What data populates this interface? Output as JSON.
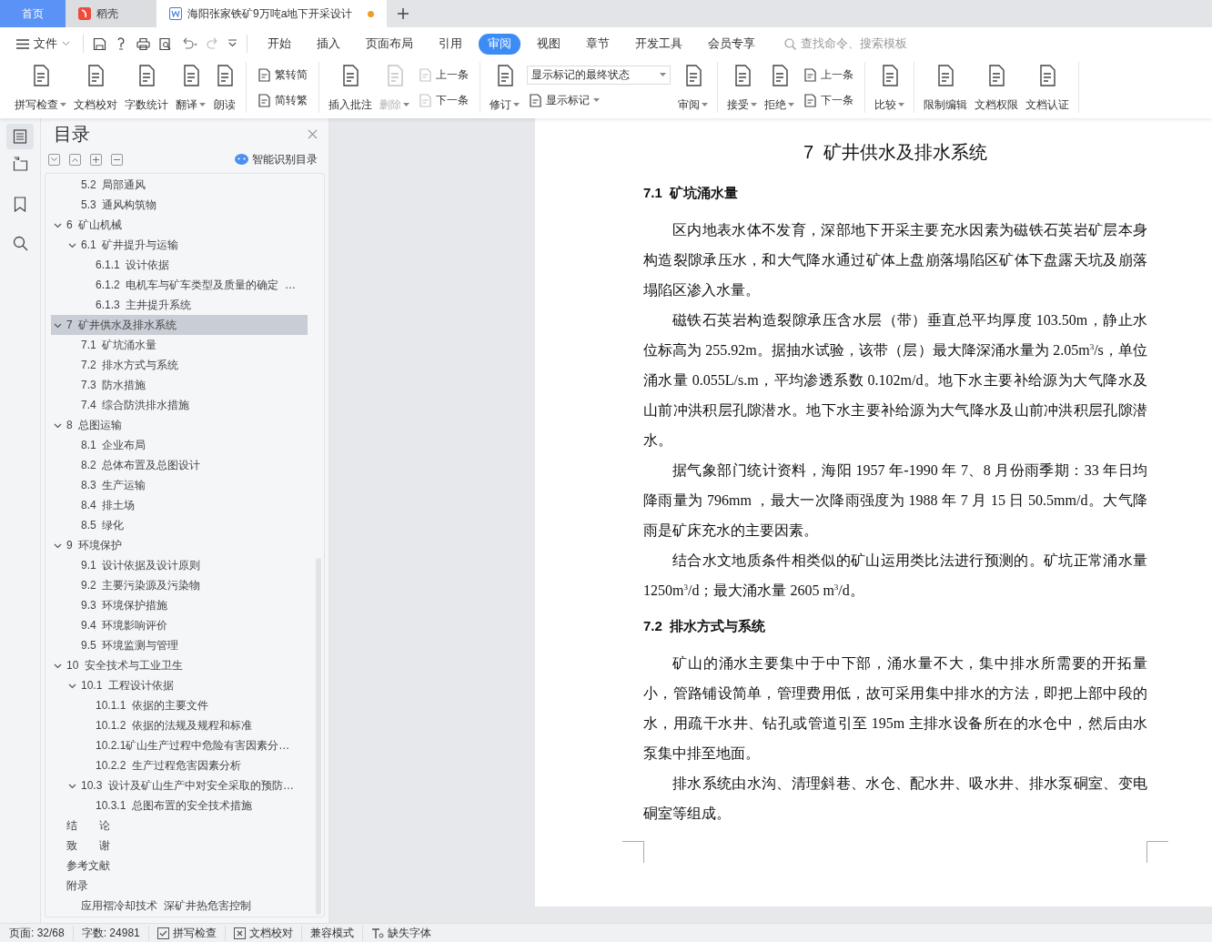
{
  "tabs": [
    {
      "label": "首页",
      "kind": "home",
      "selected": false
    },
    {
      "label": "稻壳",
      "kind": "app",
      "selected": false
    },
    {
      "label": "海阳张家铁矿9万吨a地下开采设计",
      "kind": "document",
      "selected": true,
      "modified": true
    }
  ],
  "menu": {
    "file": "文件",
    "tabs": [
      {
        "label": "开始",
        "selected": false
      },
      {
        "label": "插入",
        "selected": false
      },
      {
        "label": "页面布局",
        "selected": false
      },
      {
        "label": "引用",
        "selected": false
      },
      {
        "label": "审阅",
        "selected": true
      },
      {
        "label": "视图",
        "selected": false
      },
      {
        "label": "章节",
        "selected": false
      },
      {
        "label": "开发工具",
        "selected": false
      },
      {
        "label": "会员专享",
        "selected": false
      }
    ],
    "search": {
      "placeholder": "查找命令、搜索模板"
    }
  },
  "ribbon": {
    "groups": [
      {
        "items": [
          {
            "kind": "large",
            "label": "拼写检查",
            "dropdown": true,
            "disabled": false
          },
          {
            "kind": "large",
            "label": "文档校对",
            "dropdown": false,
            "disabled": false
          },
          {
            "kind": "large",
            "label": "字数统计",
            "dropdown": false,
            "disabled": false
          },
          {
            "kind": "large",
            "label": "翻译",
            "dropdown": true,
            "disabled": false
          },
          {
            "kind": "large",
            "label": "朗读",
            "dropdown": false,
            "disabled": false
          }
        ]
      },
      {
        "items": [
          {
            "kind": "stack",
            "items": [
              {
                "kind": "small",
                "label": "繁转简",
                "dropdown": false,
                "disabled": false
              },
              {
                "kind": "small",
                "label": "简转繁",
                "dropdown": false,
                "disabled": false
              }
            ]
          }
        ]
      },
      {
        "items": [
          {
            "kind": "large",
            "label": "插入批注",
            "dropdown": false,
            "disabled": false
          },
          {
            "kind": "large",
            "label": "删除",
            "dropdown": true,
            "disabled": true
          },
          {
            "kind": "stack",
            "items": [
              {
                "kind": "small",
                "label": "上一条",
                "dropdown": false,
                "disabled": true
              },
              {
                "kind": "small",
                "label": "下一条",
                "dropdown": false,
                "disabled": true
              }
            ]
          }
        ]
      },
      {
        "items": [
          {
            "kind": "large",
            "label": "修订",
            "dropdown": true,
            "disabled": false
          },
          {
            "kind": "stack",
            "items": [
              {
                "kind": "select",
                "value": "显示标记的最终状态"
              },
              {
                "kind": "small",
                "label": "显示标记",
                "dropdown": true,
                "disabled": false
              }
            ]
          },
          {
            "kind": "large",
            "label": "审阅",
            "dropdown": true,
            "disabled": false
          }
        ]
      },
      {
        "items": [
          {
            "kind": "large",
            "label": "接受",
            "dropdown": true,
            "disabled": false
          },
          {
            "kind": "large",
            "label": "拒绝",
            "dropdown": true,
            "disabled": false
          },
          {
            "kind": "stack",
            "items": [
              {
                "kind": "small",
                "label": "上一条",
                "dropdown": false,
                "disabled": false
              },
              {
                "kind": "small",
                "label": "下一条",
                "dropdown": false,
                "disabled": false
              }
            ]
          }
        ]
      },
      {
        "items": [
          {
            "kind": "large",
            "label": "比较",
            "dropdown": true,
            "disabled": false
          }
        ]
      },
      {
        "items": [
          {
            "kind": "large",
            "label": "限制编辑",
            "dropdown": false,
            "disabled": false
          },
          {
            "kind": "large",
            "label": "文档权限",
            "dropdown": false,
            "disabled": false
          },
          {
            "kind": "large",
            "label": "文档认证",
            "dropdown": false,
            "disabled": false
          }
        ]
      }
    ]
  },
  "toc": {
    "title": "目录",
    "smart_button": "智能识别目录",
    "items": [
      {
        "children": [
          {
            "label": "5.2  局部通风",
            "selected": false
          },
          {
            "label": "5.3  通风构筑物",
            "selected": false
          }
        ]
      },
      {
        "label": "6  矿山机械",
        "selected": false,
        "expanded": true,
        "children": [
          {
            "label": "6.1  矿井提升与运输",
            "selected": false,
            "expanded": true,
            "children": [
              {
                "label": "6.1.1  设计依据",
                "selected": false
              },
              {
                "label": "6.1.2  电机车与矿车类型及质量的确定  …",
                "selected": false
              },
              {
                "label": "6.1.3  主井提升系统",
                "selected": false
              }
            ]
          }
        ]
      },
      {
        "label": "7  矿井供水及排水系统",
        "selected": true,
        "expanded": true,
        "children": [
          {
            "label": "7.1  矿坑涌水量",
            "selected": false
          },
          {
            "label": "7.2  排水方式与系统",
            "selected": false
          },
          {
            "label": "7.3  防水措施",
            "selected": false
          },
          {
            "label": "7.4  综合防洪排水措施",
            "selected": false
          }
        ]
      },
      {
        "label": "8  总图运输",
        "selected": false,
        "expanded": true,
        "children": [
          {
            "label": "8.1  企业布局",
            "selected": false
          },
          {
            "label": "8.2  总体布置及总图设计",
            "selected": false
          },
          {
            "label": "8.3  生产运输",
            "selected": false
          },
          {
            "label": "8.4  排土场",
            "selected": false
          },
          {
            "label": "8.5  绿化",
            "selected": false
          }
        ]
      },
      {
        "label": "9  环境保护",
        "selected": false,
        "expanded": true,
        "children": [
          {
            "label": "9.1  设计依据及设计原则",
            "selected": false
          },
          {
            "label": "9.2  主要污染源及污染物",
            "selected": false
          },
          {
            "label": "9.3  环境保护措施",
            "selected": false
          },
          {
            "label": "9.4  环境影响评价",
            "selected": false
          },
          {
            "label": "9.5  环境监测与管理",
            "selected": false
          }
        ]
      },
      {
        "label": "10  安全技术与工业卫生",
        "selected": false,
        "expanded": true,
        "children": [
          {
            "label": "10.1  工程设计依据",
            "selected": false,
            "expanded": true,
            "children": [
              {
                "label": "10.1.1  依据的主要文件",
                "selected": false
              },
              {
                "label": "10.1.2  依据的法规及规程和标准",
                "selected": false
              },
              {
                "label": "10.2.1矿山生产过程中危险有害因素分…",
                "selected": false
              },
              {
                "label": "10.2.2  生产过程危害因素分析",
                "selected": false
              }
            ]
          },
          {
            "label": "10.3  设计及矿山生产中对安全采取的预防…",
            "selected": false,
            "expanded": true,
            "children": [
              {
                "label": "10.3.1  总图布置的安全技术措施",
                "selected": false
              }
            ]
          }
        ]
      },
      {
        "label": "结　　论",
        "selected": false
      },
      {
        "label": "致　　谢",
        "selected": false
      },
      {
        "label": "参考文献",
        "selected": false
      },
      {
        "label": "附录",
        "selected": false,
        "children": [
          {
            "label": "应用褶冷却技术  深矿井热危害控制",
            "selected": false
          }
        ]
      }
    ]
  },
  "document": {
    "title": "7  矿井供水及排水系统",
    "blocks": [
      {
        "kind": "heading",
        "text": "7.1  矿坑涌水量"
      },
      {
        "kind": "paragraph",
        "text": "区内地表水体不发育，深部地下开采主要充水因素为磁铁石英岩矿层本身构造裂隙承压水，和大气降水通过矿体上盘崩落塌陷区矿体下盘露天坑及崩落塌陷区渗入水量。"
      },
      {
        "kind": "paragraph",
        "text": "磁铁石英岩构造裂隙承压含水层（带）垂直总平均厚度 103.50m，静止水位标高为 255.92m。据抽水试验，该带（层）最大降深涌水量为 2.05m$^{3}$/s，单位涌水量 0.055L/s.m，平均渗透系数 0.102m/d。地下水主要补给源为大气降水及山前冲洪积层孔隙潜水。地下水主要补给源为大气降水及山前冲洪积层孔隙潜水。"
      },
      {
        "kind": "paragraph",
        "text": "据气象部门统计资料，海阳 1957 年-1990 年 7、8 月份雨季期：33 年日均降雨量为 796mm ，最大一次降雨强度为 1988 年 7 月 15 日 50.5mm/d。大气降雨是矿床充水的主要因素。"
      },
      {
        "kind": "paragraph",
        "text": "结合水文地质条件相类似的矿山运用类比法进行预测的。矿坑正常涌水量 1250m$^{3}$/d；最大涌水量 2605 m$^{3}$/d。"
      },
      {
        "kind": "heading",
        "text": "7.2  排水方式与系统"
      },
      {
        "kind": "paragraph",
        "text": "矿山的涌水主要集中于中下部，涌水量不大，集中排水所需要的开拓量小，管路铺设简单，管理费用低，故可采用集中排水的方法，即把上部中段的水，用疏干水井、钻孔或管道引至 195m 主排水设备所在的水仓中，然后由水泵集中排至地面。"
      },
      {
        "kind": "paragraph",
        "text": "排水系统由水沟、清理斜巷、水仓、配水井、吸水井、排水泵硐室、变电硐室等组成。"
      }
    ]
  },
  "status_bar": {
    "items": [
      {
        "kind": "plain",
        "label": "页面: 32/68"
      },
      {
        "kind": "plain",
        "label": "字数: 24981"
      },
      {
        "kind": "check",
        "label": "拼写检查"
      },
      {
        "kind": "cross",
        "label": "文档校对"
      },
      {
        "kind": "plain",
        "label": "兼容模式"
      },
      {
        "kind": "font",
        "label": "缺失字体"
      }
    ]
  }
}
